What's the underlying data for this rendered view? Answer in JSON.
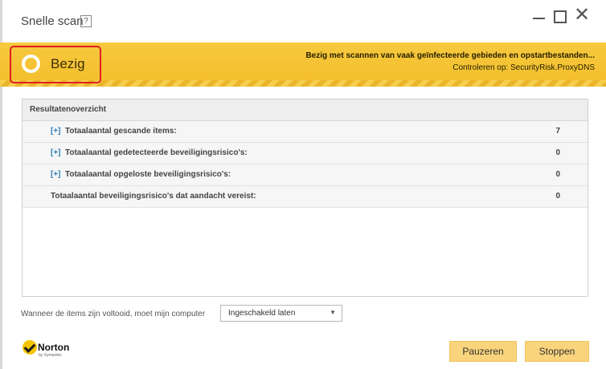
{
  "window": {
    "title": "Snelle scan",
    "help_label": "?",
    "close_glyph": "✕"
  },
  "banner": {
    "status": "Bezig",
    "scan_message": "Bezig met scannen van vaak geïnfecteerde gebieden en opstartbestanden...",
    "scan_target": "Controleren op: SecurityRisk.ProxyDNS",
    "colors": {
      "banner": "#f3be2a",
      "highlight_border": "#e02020"
    }
  },
  "results": {
    "header": "Resultatenoverzicht",
    "rows": [
      {
        "expand": "[+]",
        "label": "Totaalaantal gescande items:",
        "value": "7"
      },
      {
        "expand": "[+]",
        "label": "Totaalaantal gedetecteerde beveiligingsrisico's:",
        "value": "0"
      },
      {
        "expand": "[+]",
        "label": "Totaalaantal opgeloste beveiligingsrisico's:",
        "value": "0"
      },
      {
        "label": "Totaalaantal beveiligingsrisico's dat aandacht vereist:",
        "value": "0"
      }
    ]
  },
  "footer": {
    "completion_question": "Wanneer de items zijn voltooid, moet mijn computer",
    "completion_select": "Ingeschakeld laten",
    "select_arrow": "▼"
  },
  "logo": {
    "name": "Norton",
    "sub": "by Symantec"
  },
  "buttons": {
    "pause": "Pauzeren",
    "stop": "Stoppen",
    "color": "#f9d47c"
  }
}
